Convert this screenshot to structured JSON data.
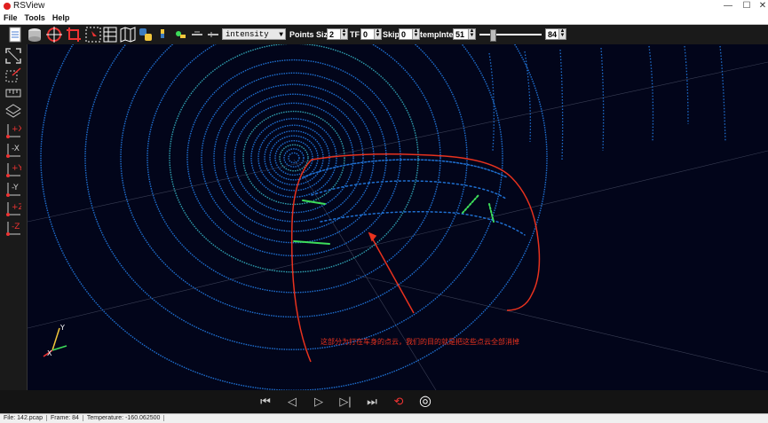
{
  "window": {
    "title": "RSView",
    "minimize": "—",
    "maximize": "☐",
    "close": "✕"
  },
  "menu": [
    "File",
    "Tools",
    "Help"
  ],
  "toolbar": {
    "color_mode": "intensity",
    "points_size_label": "Points Size",
    "points_size_value": "2",
    "tf_label": "TF",
    "tf_value": "0",
    "skip_label": "Skip",
    "skip_value": "0",
    "temp_inten_label": "tempInten",
    "temp_inten_value": "51",
    "slider_value": "84"
  },
  "sidebar": [
    "fit-view-icon",
    "reset-view-icon",
    "ruler-icon",
    "layers-icon",
    "axis-plus-x-icon",
    "axis-minus-x-icon",
    "axis-plus-y-icon",
    "axis-minus-y-icon",
    "axis-plus-z-icon",
    "axis-minus-z-icon"
  ],
  "axes": {
    "x": "X",
    "y": "Y"
  },
  "annotation": "这部分为打在车身的点云，我们的目的就是把这些点云全部消掉",
  "playback": {
    "first": "⏮",
    "prev": "◁",
    "play": "▷",
    "next": "▷|",
    "last": "⏭",
    "loop": "⟲",
    "record": "◎"
  },
  "status": {
    "file": "File: 142.pcap",
    "frame": "Frame: 84",
    "temperature": "Temperature: -160.062500"
  },
  "colors": {
    "accent_red": "#e8321e",
    "point_blue": "#1f6fd0",
    "point_green": "#3ddc5a",
    "background": "#02051a"
  }
}
